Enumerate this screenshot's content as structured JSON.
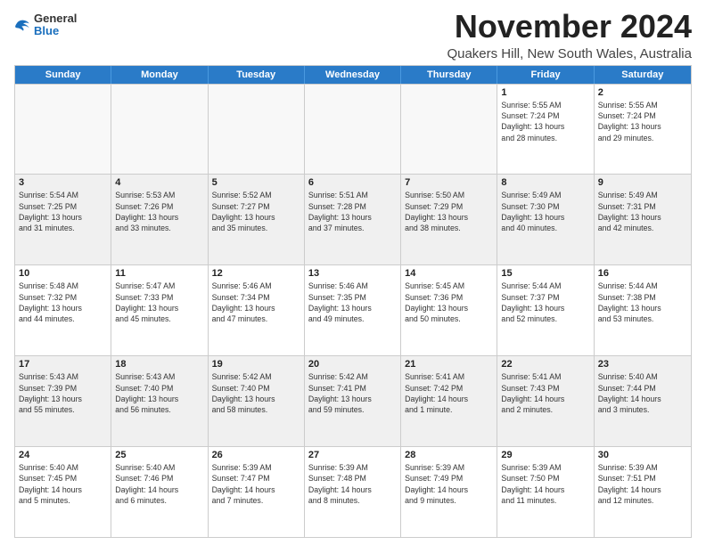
{
  "header": {
    "logo_general": "General",
    "logo_blue": "Blue",
    "month_title": "November 2024",
    "location": "Quakers Hill, New South Wales, Australia"
  },
  "calendar": {
    "days_of_week": [
      "Sunday",
      "Monday",
      "Tuesday",
      "Wednesday",
      "Thursday",
      "Friday",
      "Saturday"
    ],
    "rows": [
      [
        {
          "day": "",
          "info": "",
          "empty": true
        },
        {
          "day": "",
          "info": "",
          "empty": true
        },
        {
          "day": "",
          "info": "",
          "empty": true
        },
        {
          "day": "",
          "info": "",
          "empty": true
        },
        {
          "day": "",
          "info": "",
          "empty": true
        },
        {
          "day": "1",
          "info": "Sunrise: 5:55 AM\nSunset: 7:24 PM\nDaylight: 13 hours\nand 28 minutes."
        },
        {
          "day": "2",
          "info": "Sunrise: 5:55 AM\nSunset: 7:24 PM\nDaylight: 13 hours\nand 29 minutes."
        }
      ],
      [
        {
          "day": "3",
          "info": "Sunrise: 5:54 AM\nSunset: 7:25 PM\nDaylight: 13 hours\nand 31 minutes."
        },
        {
          "day": "4",
          "info": "Sunrise: 5:53 AM\nSunset: 7:26 PM\nDaylight: 13 hours\nand 33 minutes."
        },
        {
          "day": "5",
          "info": "Sunrise: 5:52 AM\nSunset: 7:27 PM\nDaylight: 13 hours\nand 35 minutes."
        },
        {
          "day": "6",
          "info": "Sunrise: 5:51 AM\nSunset: 7:28 PM\nDaylight: 13 hours\nand 37 minutes."
        },
        {
          "day": "7",
          "info": "Sunrise: 5:50 AM\nSunset: 7:29 PM\nDaylight: 13 hours\nand 38 minutes."
        },
        {
          "day": "8",
          "info": "Sunrise: 5:49 AM\nSunset: 7:30 PM\nDaylight: 13 hours\nand 40 minutes."
        },
        {
          "day": "9",
          "info": "Sunrise: 5:49 AM\nSunset: 7:31 PM\nDaylight: 13 hours\nand 42 minutes."
        }
      ],
      [
        {
          "day": "10",
          "info": "Sunrise: 5:48 AM\nSunset: 7:32 PM\nDaylight: 13 hours\nand 44 minutes."
        },
        {
          "day": "11",
          "info": "Sunrise: 5:47 AM\nSunset: 7:33 PM\nDaylight: 13 hours\nand 45 minutes."
        },
        {
          "day": "12",
          "info": "Sunrise: 5:46 AM\nSunset: 7:34 PM\nDaylight: 13 hours\nand 47 minutes."
        },
        {
          "day": "13",
          "info": "Sunrise: 5:46 AM\nSunset: 7:35 PM\nDaylight: 13 hours\nand 49 minutes."
        },
        {
          "day": "14",
          "info": "Sunrise: 5:45 AM\nSunset: 7:36 PM\nDaylight: 13 hours\nand 50 minutes."
        },
        {
          "day": "15",
          "info": "Sunrise: 5:44 AM\nSunset: 7:37 PM\nDaylight: 13 hours\nand 52 minutes."
        },
        {
          "day": "16",
          "info": "Sunrise: 5:44 AM\nSunset: 7:38 PM\nDaylight: 13 hours\nand 53 minutes."
        }
      ],
      [
        {
          "day": "17",
          "info": "Sunrise: 5:43 AM\nSunset: 7:39 PM\nDaylight: 13 hours\nand 55 minutes."
        },
        {
          "day": "18",
          "info": "Sunrise: 5:43 AM\nSunset: 7:40 PM\nDaylight: 13 hours\nand 56 minutes."
        },
        {
          "day": "19",
          "info": "Sunrise: 5:42 AM\nSunset: 7:40 PM\nDaylight: 13 hours\nand 58 minutes."
        },
        {
          "day": "20",
          "info": "Sunrise: 5:42 AM\nSunset: 7:41 PM\nDaylight: 13 hours\nand 59 minutes."
        },
        {
          "day": "21",
          "info": "Sunrise: 5:41 AM\nSunset: 7:42 PM\nDaylight: 14 hours\nand 1 minute."
        },
        {
          "day": "22",
          "info": "Sunrise: 5:41 AM\nSunset: 7:43 PM\nDaylight: 14 hours\nand 2 minutes."
        },
        {
          "day": "23",
          "info": "Sunrise: 5:40 AM\nSunset: 7:44 PM\nDaylight: 14 hours\nand 3 minutes."
        }
      ],
      [
        {
          "day": "24",
          "info": "Sunrise: 5:40 AM\nSunset: 7:45 PM\nDaylight: 14 hours\nand 5 minutes."
        },
        {
          "day": "25",
          "info": "Sunrise: 5:40 AM\nSunset: 7:46 PM\nDaylight: 14 hours\nand 6 minutes."
        },
        {
          "day": "26",
          "info": "Sunrise: 5:39 AM\nSunset: 7:47 PM\nDaylight: 14 hours\nand 7 minutes."
        },
        {
          "day": "27",
          "info": "Sunrise: 5:39 AM\nSunset: 7:48 PM\nDaylight: 14 hours\nand 8 minutes."
        },
        {
          "day": "28",
          "info": "Sunrise: 5:39 AM\nSunset: 7:49 PM\nDaylight: 14 hours\nand 9 minutes."
        },
        {
          "day": "29",
          "info": "Sunrise: 5:39 AM\nSunset: 7:50 PM\nDaylight: 14 hours\nand 11 minutes."
        },
        {
          "day": "30",
          "info": "Sunrise: 5:39 AM\nSunset: 7:51 PM\nDaylight: 14 hours\nand 12 minutes."
        }
      ]
    ]
  }
}
